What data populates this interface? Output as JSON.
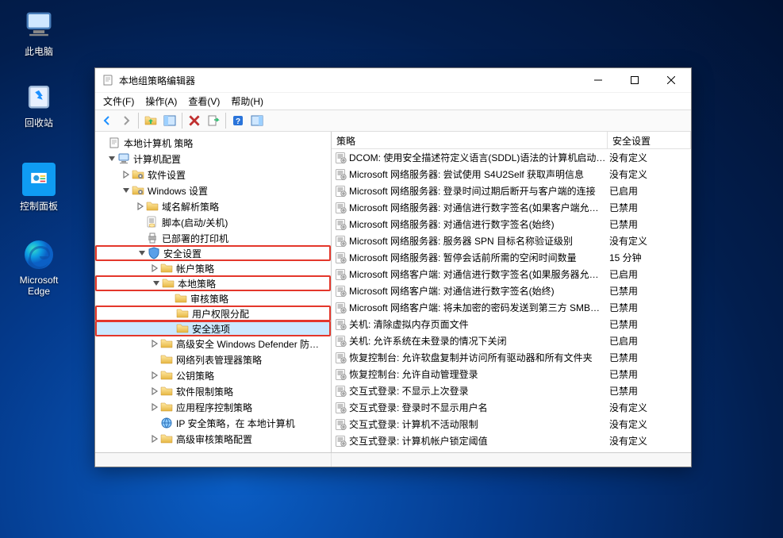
{
  "desktop": {
    "icons": [
      {
        "name": "pc-icon",
        "label": "此电脑"
      },
      {
        "name": "recycle-icon",
        "label": "回收站"
      },
      {
        "name": "control-panel-icon",
        "label": "控制面板"
      },
      {
        "name": "edge-icon",
        "label": "Microsoft Edge"
      }
    ]
  },
  "window": {
    "title": "本地组策略编辑器",
    "menus": [
      {
        "label": "文件(F)"
      },
      {
        "label": "操作(A)"
      },
      {
        "label": "查看(V)"
      },
      {
        "label": "帮助(H)"
      }
    ],
    "toolbar": [
      {
        "name": "nav-back-icon"
      },
      {
        "name": "nav-forward-icon"
      },
      {
        "sep": true
      },
      {
        "name": "up-level-icon"
      },
      {
        "name": "show-hide-tree-icon"
      },
      {
        "sep": true
      },
      {
        "name": "delete-icon"
      },
      {
        "name": "export-list-icon"
      },
      {
        "sep": true
      },
      {
        "name": "help-icon"
      },
      {
        "name": "show-hide-action-icon"
      }
    ],
    "tree": {
      "root_label": "本地计算机 策略",
      "comp_config": "计算机配置",
      "soft_settings": "软件设置",
      "win_settings": "Windows 设置",
      "dns_policy": "域名解析策略",
      "scripts": "脚本(启动/关机)",
      "printers": "已部署的打印机",
      "sec_settings": "安全设置",
      "account_policy": "帐户策略",
      "local_policy": "本地策略",
      "audit_policy": "审核策略",
      "user_rights": "用户权限分配",
      "sec_options": "安全选项",
      "defender": "高级安全 Windows Defender 防…",
      "netlist": "网络列表管理器策略",
      "pubkey": "公钥策略",
      "soft_restrict": "软件限制策略",
      "appctrl": "应用程序控制策略",
      "ipsec": "IP 安全策略，在 本地计算机",
      "adv_audit": "高级审核策略配置"
    },
    "list_headers": {
      "c1": "策略",
      "c2": "安全设置"
    },
    "policies": [
      {
        "name": "DCOM: 使用安全描述符定义语言(SDDL)语法的计算机启动…",
        "setting": "没有定义"
      },
      {
        "name": "Microsoft 网络服务器: 尝试使用 S4U2Self 获取声明信息",
        "setting": "没有定义"
      },
      {
        "name": "Microsoft 网络服务器: 登录时间过期后断开与客户端的连接",
        "setting": "已启用"
      },
      {
        "name": "Microsoft 网络服务器: 对通信进行数字签名(如果客户端允…",
        "setting": "已禁用"
      },
      {
        "name": "Microsoft 网络服务器: 对通信进行数字签名(始终)",
        "setting": "已禁用"
      },
      {
        "name": "Microsoft 网络服务器: 服务器 SPN 目标名称验证级别",
        "setting": "没有定义"
      },
      {
        "name": "Microsoft 网络服务器: 暂停会话前所需的空闲时间数量",
        "setting": "15 分钟"
      },
      {
        "name": "Microsoft 网络客户端: 对通信进行数字签名(如果服务器允…",
        "setting": "已启用"
      },
      {
        "name": "Microsoft 网络客户端: 对通信进行数字签名(始终)",
        "setting": "已禁用"
      },
      {
        "name": "Microsoft 网络客户端: 将未加密的密码发送到第三方 SMB…",
        "setting": "已禁用"
      },
      {
        "name": "关机: 清除虚拟内存页面文件",
        "setting": "已禁用"
      },
      {
        "name": "关机: 允许系统在未登录的情况下关闭",
        "setting": "已启用"
      },
      {
        "name": "恢复控制台: 允许软盘复制并访问所有驱动器和所有文件夹",
        "setting": "已禁用"
      },
      {
        "name": "恢复控制台: 允许自动管理登录",
        "setting": "已禁用"
      },
      {
        "name": "交互式登录: 不显示上次登录",
        "setting": "已禁用"
      },
      {
        "name": "交互式登录: 登录时不显示用户名",
        "setting": "没有定义"
      },
      {
        "name": "交互式登录: 计算机不活动限制",
        "setting": "没有定义"
      },
      {
        "name": "交互式登录: 计算机帐户锁定阈值",
        "setting": "没有定义"
      }
    ]
  }
}
